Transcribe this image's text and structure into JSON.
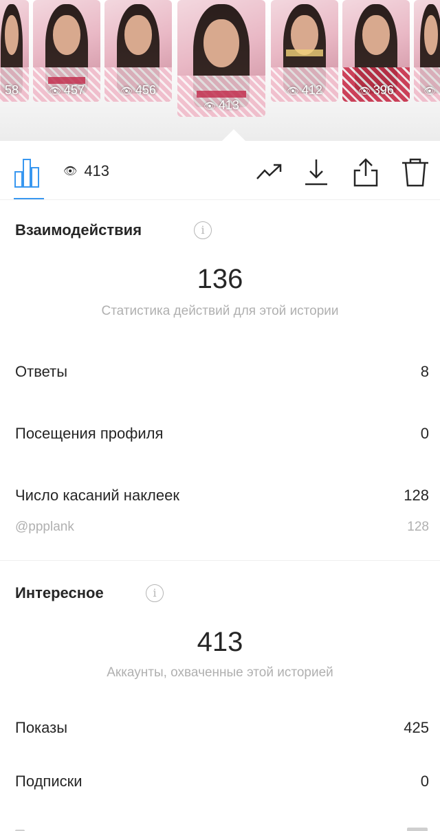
{
  "stories": [
    {
      "views": "58"
    },
    {
      "views": "457"
    },
    {
      "views": "456"
    },
    {
      "views": "413",
      "selected": true
    },
    {
      "views": "412"
    },
    {
      "views": "396"
    },
    {
      "views": ""
    }
  ],
  "toolbar": {
    "views_count": "413",
    "icons": [
      "bar-chart-icon",
      "eye-icon",
      "trend-icon",
      "download-icon",
      "share-icon",
      "trash-icon"
    ],
    "accent_color": "#3897f0"
  },
  "interactions": {
    "title": "Взаимодействия",
    "total": "136",
    "caption": "Статистика действий для этой истории",
    "rows": [
      {
        "label": "Ответы",
        "value": "8"
      },
      {
        "label": "Посещения профиля",
        "value": "0"
      },
      {
        "label": "Число касаний наклеек",
        "value": "128"
      }
    ],
    "sticker": {
      "label": "@ppplank",
      "value": "128"
    }
  },
  "discovery": {
    "title": "Интересное",
    "total": "413",
    "caption": "Аккаунты, охваченные этой историей",
    "rows": [
      {
        "label": "Показы",
        "value": "425"
      },
      {
        "label": "Подписки",
        "value": "0"
      }
    ]
  }
}
